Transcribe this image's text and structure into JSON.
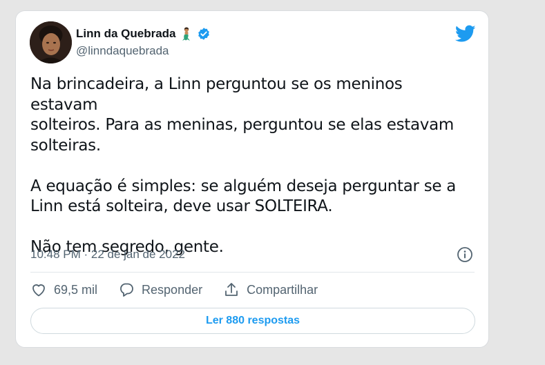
{
  "tweet": {
    "author": {
      "display_name": "Linn da Quebrada",
      "handle": "@linndaquebrada",
      "emoji_icon": "mermaid-icon",
      "verified": true
    },
    "text": "Na brincadeira, a Linn perguntou se os meninos estavam\nsolteiros. Para as meninas, perguntou se elas estavam\nsolteiras.\n\nA equação é simples: se alguém deseja perguntar se a\nLinn está solteira, deve usar SOLTEIRA.\n\nNão tem segredo, gente.",
    "timestamp": "10:48 PM · 22 de jan de 2022"
  },
  "actions": {
    "like_count": "69,5 mil",
    "reply_label": "Responder",
    "share_label": "Compartilhar"
  },
  "replies_button": "Ler 880 respostas",
  "colors": {
    "accent": "#1d9bf0",
    "verified": "#1d9bf0",
    "text": "#0f1419",
    "secondary": "#536471",
    "background": "#e6e6e6"
  }
}
